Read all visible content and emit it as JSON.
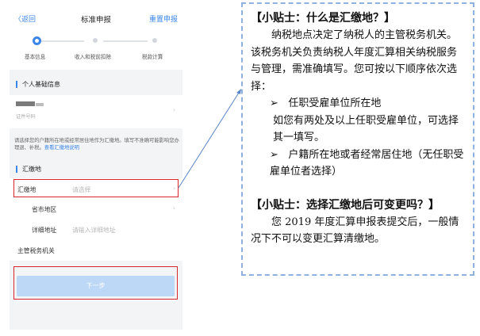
{
  "phone": {
    "nav": {
      "back": "〈返回",
      "title": "标准申报",
      "reset": "重置申报"
    },
    "steps": [
      "基本信息",
      "收入和税前扣除",
      "税款计算"
    ],
    "section_personal": "个人基础信息",
    "id_label": "证件号码",
    "notice_text": "请选择您的户籍所在地或经常居住地作为汇缴地。填写不准确可能影响您办理退、补税。",
    "notice_link": "查看汇缴地说明",
    "section_place": "汇缴地",
    "place_label": "汇缴地",
    "place_placeholder": "请选择",
    "region_label": "省市地区",
    "address_label": "详细地址",
    "address_placeholder": "请输入详细地址",
    "tax_office_label": "主管税务机关",
    "next_button": "下一步"
  },
  "tips": {
    "heading1": "【小贴士：什么是汇缴地？】",
    "para1": "纳税地点决定了纳税人的主管税务机关。该税务机关负责纳税人年度汇算相关纳税服务与管理，需准确填写。您可按以下顺序依次选择：",
    "option1_bullet": "➢",
    "option1": "任职受雇单位所在地",
    "option1_note": "如您有两处及以上任职受雇单位，可选择其一填写。",
    "option2_bullet": "➢",
    "option2": "户籍所在地或者经常居住地（无任职受雇单位者选择）",
    "heading2": "【小贴士：选择汇缴地后可变更吗？】",
    "para2": "您 2019 年度汇算申报表提交后，一般情况下不可以变更汇算清缴地。"
  }
}
